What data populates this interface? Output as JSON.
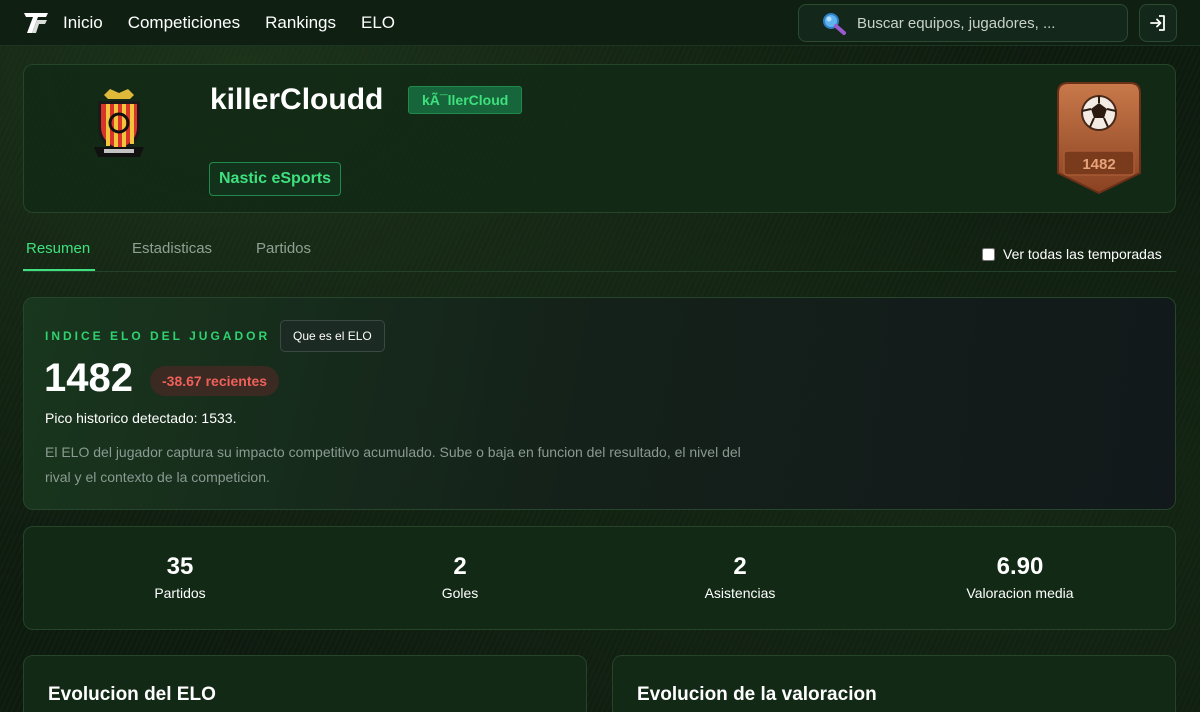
{
  "nav": {
    "items": [
      "Inicio",
      "Competiciones",
      "Rankings",
      "ELO"
    ],
    "search_placeholder": "Buscar equipos, jugadores, ..."
  },
  "profile": {
    "name": "killerCloudd",
    "alias": "kÃ¯llerCloud",
    "team": "Nastic eSports",
    "medal_value": "1482"
  },
  "tabs": {
    "items": [
      "Resumen",
      "Estadisticas",
      "Partidos"
    ],
    "active": "Resumen",
    "season_toggle_label": "Ver todas las temporadas"
  },
  "elo": {
    "kicker": "INDICE ELO DEL JUGADOR",
    "help_label": "Que es el ELO",
    "value": "1482",
    "delta": "-38.67 recientes",
    "peak": "Pico historico detectado: 1533.",
    "description": "El ELO del jugador captura su impacto competitivo acumulado. Sube o baja en funcion del resultado, el nivel del rival y el contexto de la competicion."
  },
  "stats": [
    {
      "value": "35",
      "label": "Partidos"
    },
    {
      "value": "2",
      "label": "Goles"
    },
    {
      "value": "2",
      "label": "Asistencias"
    },
    {
      "value": "6.90",
      "label": "Valoracion media"
    }
  ],
  "charts": {
    "elo_title": "Evolucion del ELO",
    "rating_title": "Evolucion de la valoracion"
  },
  "colors": {
    "accent": "#3fe07e",
    "negative": "#f0605a",
    "medal": "#b8643a"
  },
  "icons": {
    "logo": "brand-logo-icon",
    "search": "search-icon",
    "login": "login-icon",
    "crest": "team-crest-icon",
    "medal": "elo-medal-icon"
  }
}
